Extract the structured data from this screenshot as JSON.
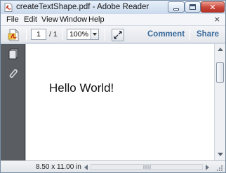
{
  "window": {
    "title": "createTextShape.pdf - Adobe Reader",
    "close_glyph": "✕"
  },
  "menu": {
    "items": [
      "File",
      "Edit",
      "View",
      "Window",
      "Help"
    ],
    "close_glyph": "×"
  },
  "toolbar": {
    "page_current": "1",
    "page_total": "/ 1",
    "zoom": "100%",
    "comment_label": "Comment",
    "share_label": "Share"
  },
  "document": {
    "text": "Hello World!"
  },
  "status": {
    "page_size": "8.50 x 11.00 in"
  },
  "icons": {
    "app": "pdf-document-icon",
    "toolbar_create": "pdf-create-icon",
    "fit": "fit-page-icon",
    "nav_pages": "page-thumbnails-icon",
    "nav_attachments": "paperclip-icon"
  },
  "colors": {
    "link_blue": "#3a6a9c",
    "nav_pane": "#5a5e63",
    "close_red": "#c8453a"
  }
}
